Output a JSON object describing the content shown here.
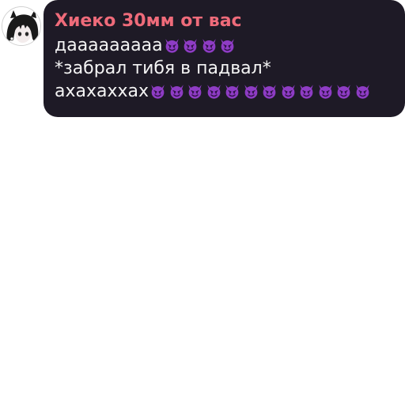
{
  "message": {
    "sender": "Хиеко 30мм от вас",
    "lines": [
      {
        "text": "дааааааааа",
        "emoji_count": 4
      },
      {
        "text": "*забрал тибя в падвал*",
        "emoji_count": 0
      },
      {
        "text": "ахахаххах",
        "emoji_count": 12
      }
    ],
    "emoji_icon": "smiling-imp-emoji"
  },
  "colors": {
    "bubble_bg": "#1e1a26",
    "sender_name": "#ef6b7a",
    "message_text": "#f4f4f4",
    "emoji_purple": "#8e3cc4"
  }
}
